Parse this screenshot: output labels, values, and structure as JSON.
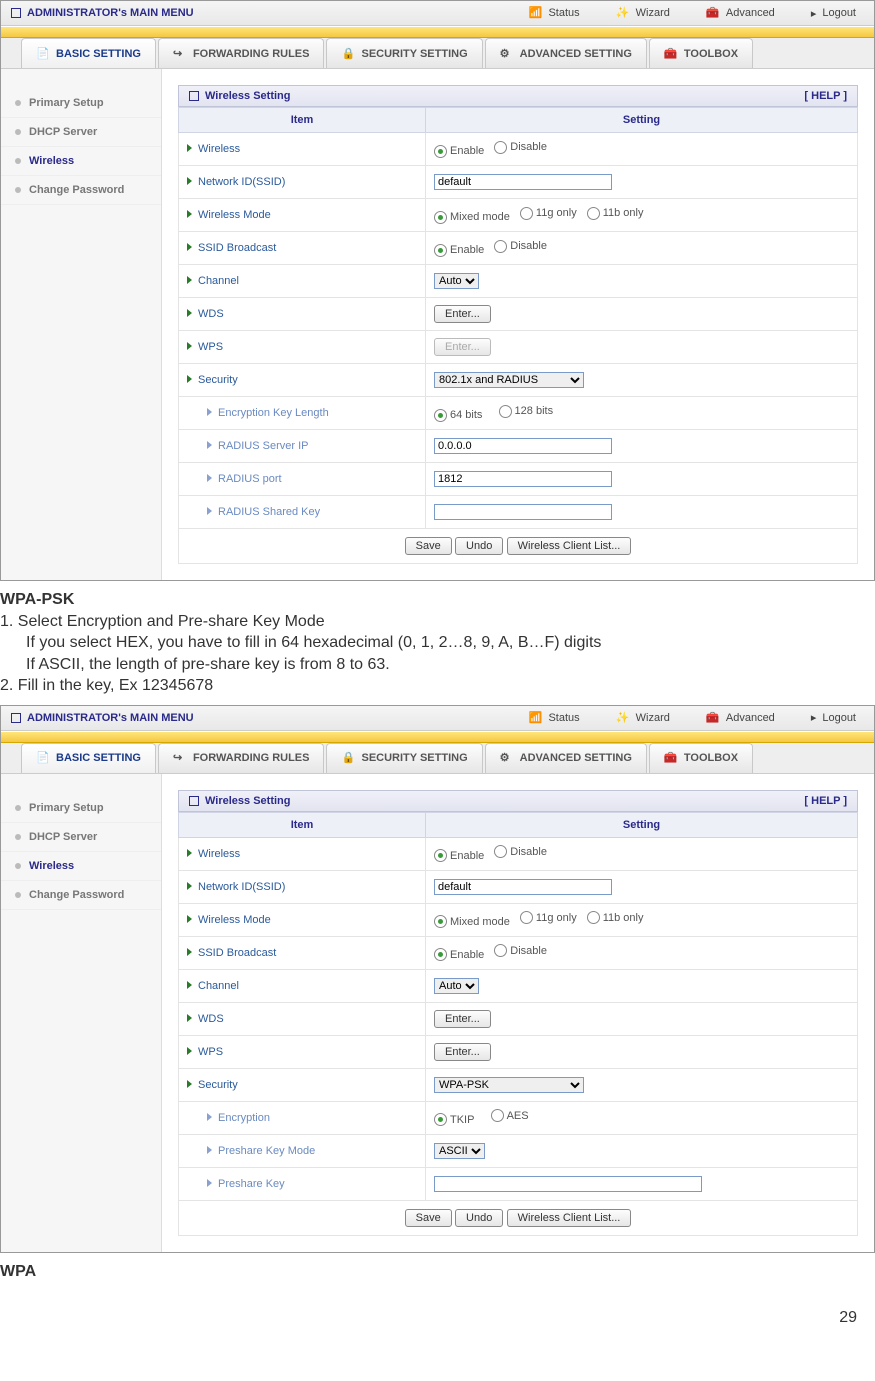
{
  "topnav": {
    "title": "ADMINISTRATOR's MAIN MENU",
    "items": [
      "Status",
      "Wizard",
      "Advanced"
    ],
    "logout": "Logout"
  },
  "tabs": [
    "BASIC SETTING",
    "FORWARDING RULES",
    "SECURITY SETTING",
    "ADVANCED SETTING",
    "TOOLBOX"
  ],
  "sidebar": [
    "Primary Setup",
    "DHCP Server",
    "Wireless",
    "Change Password"
  ],
  "panel": {
    "title": "Wireless Setting",
    "help": "[ HELP ]",
    "col_item": "Item",
    "col_setting": "Setting"
  },
  "labels": {
    "wireless": "Wireless",
    "ssid": "Network ID(SSID)",
    "mode": "Wireless Mode",
    "broadcast": "SSID Broadcast",
    "channel": "Channel",
    "wds": "WDS",
    "wps": "WPS",
    "security": "Security",
    "enc_len": "Encryption Key Length",
    "radius_ip": "RADIUS Server IP",
    "radius_port": "RADIUS port",
    "radius_key": "RADIUS Shared Key",
    "encryption": "Encryption",
    "psk_mode": "Preshare Key Mode",
    "psk": "Preshare Key"
  },
  "radios": {
    "enable": "Enable",
    "disable": "Disable",
    "mixed": "Mixed mode",
    "g_only": "11g only",
    "b_only": "11b only",
    "b64": "64 bits",
    "b128": "128 bits",
    "tkip": "TKIP",
    "aes": "AES"
  },
  "values": {
    "ssid": "default",
    "channel": "Auto",
    "radius_ip": "0.0.0.0",
    "radius_port": "1812",
    "radius_key": "",
    "security1": "802.1x and RADIUS",
    "security2": "WPA-PSK",
    "psk_mode": "ASCII",
    "psk": ""
  },
  "buttons": {
    "enter": "Enter...",
    "save": "Save",
    "undo": "Undo",
    "clients": "Wireless Client List..."
  },
  "doc": {
    "h1": "WPA-PSK",
    "l1": "1. Select Encryption and Pre-share Key Mode",
    "l2": "If you select HEX, you have to fill in 64 hexadecimal (0, 1, 2…8, 9, A, B…F) digits",
    "l3": "If ASCII, the length of pre-share key is from 8 to 63.",
    "l4": "2. Fill in the key, Ex 12345678",
    "h2": "WPA",
    "page": "29"
  }
}
